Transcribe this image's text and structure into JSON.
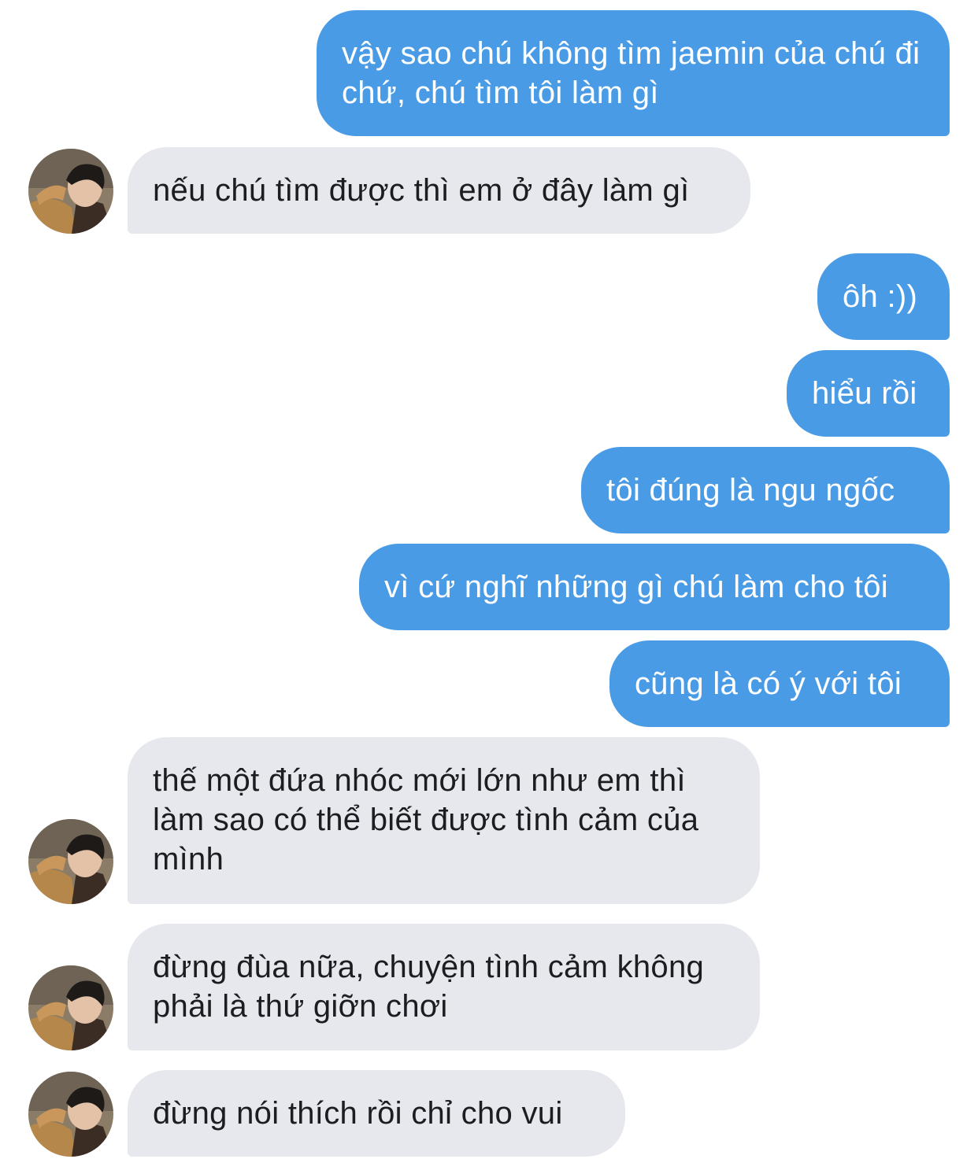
{
  "contact": {
    "avatar_icon": "profile-photo"
  },
  "messages": [
    {
      "from": "me",
      "text": "vậy sao chú không tìm jaemin của chú đi chứ, chú tìm tôi làm gì"
    },
    {
      "from": "them",
      "text": "nếu chú tìm được thì em ở đây làm gì"
    },
    {
      "from": "me",
      "text": "ôh :))"
    },
    {
      "from": "me",
      "text": "hiểu rồi"
    },
    {
      "from": "me",
      "text": "tôi đúng là ngu ngốc"
    },
    {
      "from": "me",
      "text": "vì cứ nghĩ những gì chú làm cho tôi"
    },
    {
      "from": "me",
      "text": "cũng là có ý với tôi"
    },
    {
      "from": "them",
      "text": "thế một đứa nhóc mới lớn như em thì làm sao có thể biết được tình cảm của mình"
    },
    {
      "from": "them",
      "text": "đừng đùa nữa, chuyện tình cảm không phải là thứ giỡn chơi"
    },
    {
      "from": "them",
      "text": "đừng nói thích rồi chỉ cho vui"
    }
  ],
  "colors": {
    "outgoing_bubble": "#4a9be6",
    "incoming_bubble": "#e6e8ed",
    "outgoing_text": "#ffffff",
    "incoming_text": "#1c1d21"
  }
}
